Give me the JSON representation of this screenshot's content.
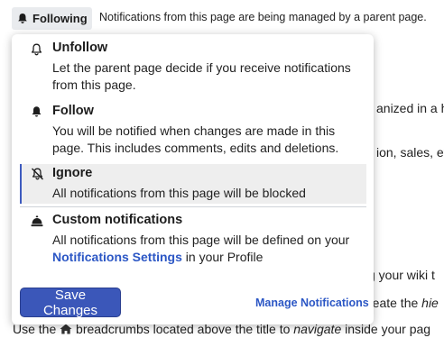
{
  "header": {
    "follow_button_label": "Following",
    "note": "Notifications from this page are being managed by a parent page."
  },
  "background_fragments": {
    "line1": "anized in a h",
    "line2": "ion, sales, et",
    "line3": "g your wiki t",
    "line4_a": "reate the ",
    "line4_b": "hie",
    "line5_a": "Use the ",
    "line5_b": " breadcrumbs located above the title to ",
    "line5_c": "navigate",
    "line5_d": " inside your pag"
  },
  "menu": {
    "options": [
      {
        "title": "Unfollow",
        "description": "Let the parent page decide if you receive notifications from this page.",
        "icon": "bell-outline-icon",
        "selected": false
      },
      {
        "title": "Follow",
        "description": "You will be notified when changes are made in this page. This includes comments, edits and deletions.",
        "icon": "bell-filled-icon",
        "selected": false
      },
      {
        "title": "Ignore",
        "description": "All notifications from this page will be blocked",
        "icon": "bell-slash-icon",
        "selected": true
      },
      {
        "title": "Custom notifications",
        "description_before": "All notifications from this page will be defined on your ",
        "description_link": "Notifications Settings",
        "description_after": " in your Profile",
        "icon": "concierge-bell-icon",
        "selected": false
      }
    ],
    "save_label": "Save Changes",
    "manage_label": "Manage Notifications"
  },
  "colors": {
    "accent": "#3b57b9",
    "link": "#2c57c5",
    "selected_bg": "#eeeeee",
    "pill_bg": "#e9ebee"
  }
}
